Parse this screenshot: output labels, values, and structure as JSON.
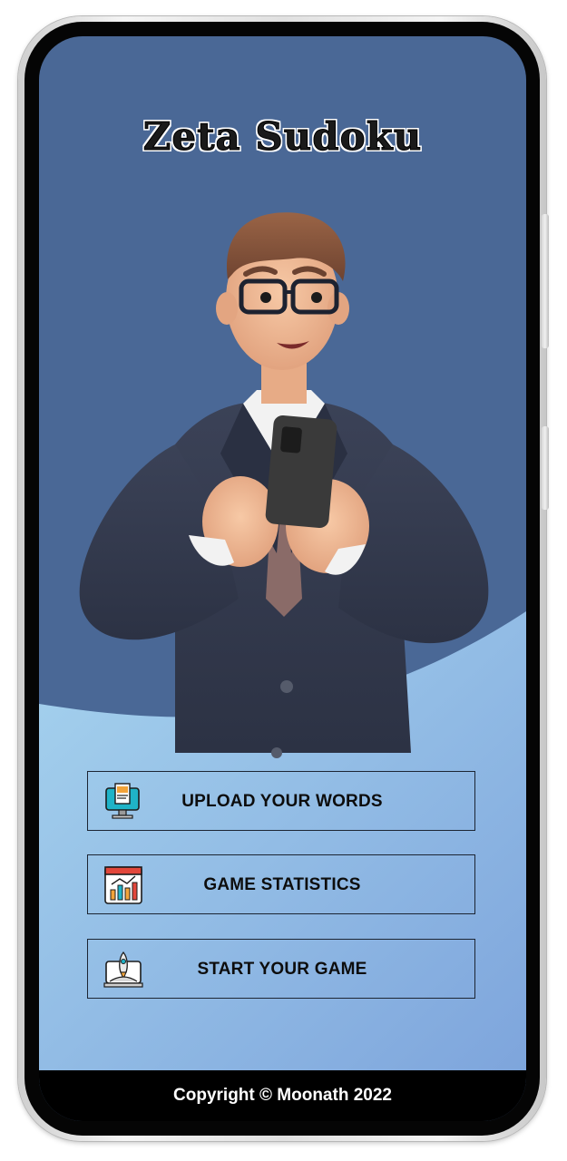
{
  "app": {
    "title": "Zeta Sudoku"
  },
  "hero": {
    "image_name": "3d-man-holding-phone"
  },
  "menu": {
    "items": [
      {
        "label": "UPLOAD YOUR WORDS",
        "icon": "computer-document-icon"
      },
      {
        "label": "GAME STATISTICS",
        "icon": "statistics-chart-icon"
      },
      {
        "label": "START YOUR GAME",
        "icon": "rocket-launch-icon"
      }
    ]
  },
  "footer": {
    "copyright": "Copyright © Moonath 2022"
  },
  "colors": {
    "header_bg": "#4a6896",
    "lower_bg_top": "#a2cdea",
    "lower_bg_bottom": "#7fa6dc",
    "button_border": "#1c2533",
    "footer_bg": "#000000"
  }
}
